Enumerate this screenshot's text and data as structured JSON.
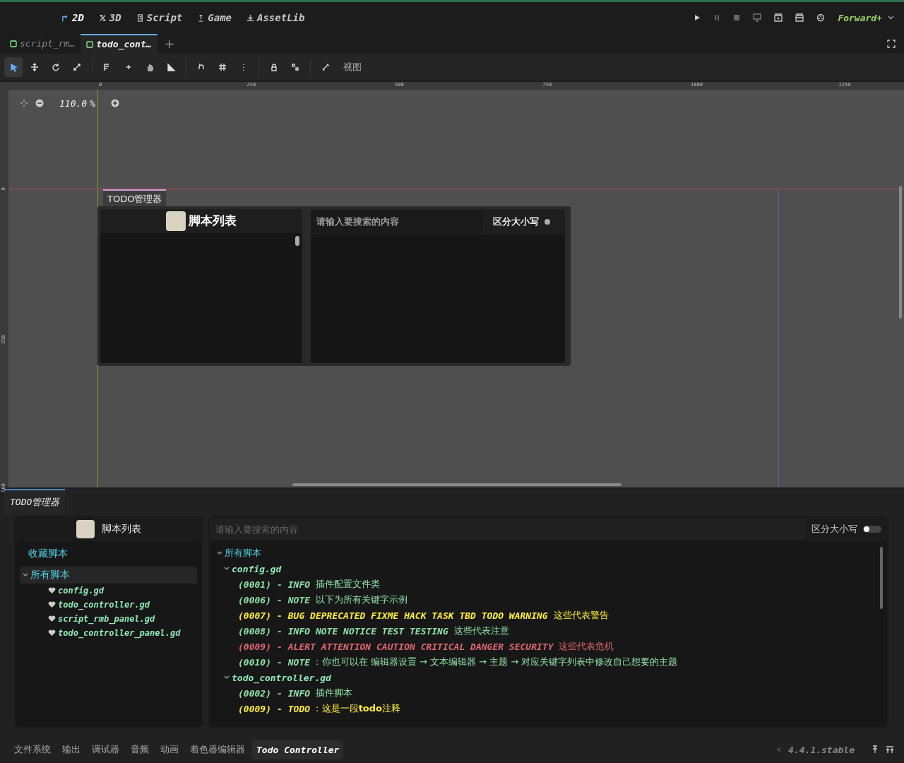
{
  "workspaces": [
    {
      "kind": "planar",
      "label": "2D",
      "selected": true
    },
    {
      "kind": "spatial",
      "label": "3D",
      "selected": false
    },
    {
      "kind": "script",
      "label": "Script",
      "selected": false
    },
    {
      "kind": "game",
      "label": "Game",
      "selected": false
    },
    {
      "kind": "assetlib",
      "label": "AssetLib",
      "selected": false
    }
  ],
  "renderer": "Forward+",
  "scene_tabs": [
    {
      "label": "script_rm…",
      "selected": false
    },
    {
      "label": "todo_cont…",
      "selected": true
    }
  ],
  "add_tab": "+",
  "toolbar": {
    "tools": [
      {
        "kind": "select",
        "selected": true
      },
      {
        "kind": "move",
        "selected": false
      },
      {
        "kind": "rotate",
        "selected": false
      },
      {
        "kind": "scale",
        "selected": false
      },
      {
        "kind": "list",
        "selected": false
      },
      {
        "kind": "pivot",
        "selected": false
      },
      {
        "kind": "pan",
        "selected": false
      },
      {
        "kind": "ruler",
        "selected": false
      },
      {
        "kind": "snap",
        "selected": false
      },
      {
        "kind": "grid",
        "selected": false
      },
      {
        "kind": "more",
        "selected": false
      },
      {
        "kind": "lock",
        "selected": false
      },
      {
        "kind": "group",
        "selected": false
      },
      {
        "kind": "bone",
        "selected": false
      }
    ],
    "view_menu": "视图"
  },
  "ruler": {
    "x_ticks": [
      "0",
      "250",
      "500",
      "750",
      "1000",
      "1250"
    ],
    "y_ticks": [
      "0",
      "250",
      "500"
    ]
  },
  "zoom": {
    "value": "110.0",
    "unit": "%"
  },
  "canvas_panel": {
    "tab": "TODO管理器",
    "list_title": "脚本列表",
    "search_placeholder": "请输入要搜索的内容",
    "case_label": "区分大小写",
    "case_on": false
  },
  "dock": {
    "tab": "TODO管理器",
    "list_title": "脚本列表",
    "favorites": {
      "label": "收藏脚本",
      "selected": false
    },
    "all_scripts": {
      "label": "所有脚本",
      "expanded": true,
      "selected": true,
      "children": [
        {
          "name": "config.gd"
        },
        {
          "name": "todo_controller.gd"
        },
        {
          "name": "script_rmb_panel.gd"
        },
        {
          "name": "todo_controller_panel.gd"
        }
      ]
    },
    "search_placeholder": "请输入要搜索的内容",
    "case_label": "区分大小写",
    "case_on": false,
    "results": {
      "label": "所有脚本",
      "expanded": true,
      "children": [
        {
          "file": "config.gd",
          "expanded": true,
          "entries": [
            {
              "line": "(0001)",
              "dash": "-",
              "keyword": "INFO",
              "text": "插件配置文件类",
              "color": "#8fe0a8"
            },
            {
              "line": "(0006)",
              "dash": "-",
              "keyword": "NOTE",
              "text": "以下为所有关键字示例",
              "color": "#8fe0a8"
            },
            {
              "line": "(0007)",
              "dash": "-",
              "keyword": "BUG DEPRECATED FIXME HACK TASK TBD TODO WARNING",
              "text": "这些代表警告",
              "color": "#ffee3a"
            },
            {
              "line": "(0008)",
              "dash": "-",
              "keyword": "INFO NOTE NOTICE TEST TESTING",
              "text": "这些代表注意",
              "color": "#8fe0a8"
            },
            {
              "line": "(0009)",
              "dash": "-",
              "keyword": "ALERT ATTENTION CAUTION CRITICAL DANGER SECURITY",
              "text": "这些代表危机",
              "color": "#e06672"
            },
            {
              "line": "(0010)",
              "dash": "-",
              "keyword": "NOTE",
              "text": ": 你也可以在  编辑器设置 → 文本编辑器 → 主题 → 对应关键字列表中修改自己想要的主题",
              "color": "#8fe0a8"
            }
          ]
        },
        {
          "file": "todo_controller.gd",
          "expanded": true,
          "entries": [
            {
              "line": "(0002)",
              "dash": "-",
              "keyword": "INFO",
              "text": "插件脚本",
              "color": "#8fe0a8"
            },
            {
              "line": "(0009)",
              "dash": "-",
              "keyword": "TODO",
              "text": ": 这是一段**todo**注释",
              "color": "#ffee3a"
            }
          ]
        }
      ]
    }
  },
  "bottom_tabs": [
    {
      "label": "文件系统",
      "selected": false
    },
    {
      "label": "输出",
      "selected": false
    },
    {
      "label": "调试器",
      "selected": false
    },
    {
      "label": "音频",
      "selected": false
    },
    {
      "label": "动画",
      "selected": false
    },
    {
      "label": "着色器编辑器",
      "selected": false
    },
    {
      "label": "Todo Controller",
      "selected": true
    }
  ],
  "version": "4.4.1.stable"
}
